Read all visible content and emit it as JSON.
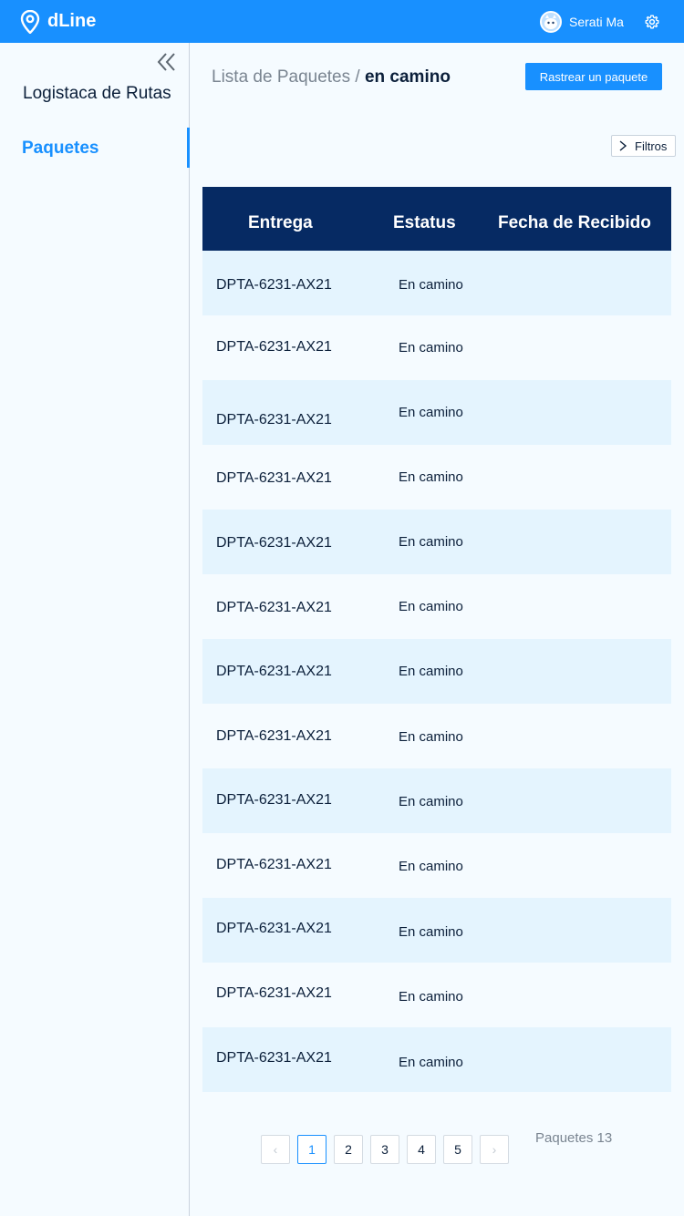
{
  "app": {
    "brand": "dLine",
    "user_name": "Serati Ma"
  },
  "sidebar": {
    "title": "Logistaca de Rutas",
    "items": [
      {
        "label": "Paquetes",
        "active": true
      }
    ]
  },
  "header": {
    "breadcrumb_parent": "Lista de Paquetes",
    "breadcrumb_separator": "/",
    "breadcrumb_current": "en camino",
    "track_button": "Rastrear un paquete",
    "filter_button": "Filtros"
  },
  "table": {
    "columns": [
      "Entrega",
      "Estatus",
      "Fecha de Recibido"
    ],
    "rows": [
      {
        "id": "DPTA-6231-AX21",
        "status": "En camino",
        "date": ""
      },
      {
        "id": "DPTA-6231-AX21",
        "status": "En camino",
        "date": ""
      },
      {
        "id": "DPTA-6231-AX21",
        "status": "En camino",
        "date": ""
      },
      {
        "id": "DPTA-6231-AX21",
        "status": "En camino",
        "date": ""
      },
      {
        "id": "DPTA-6231-AX21",
        "status": "En camino",
        "date": ""
      },
      {
        "id": "DPTA-6231-AX21",
        "status": "En camino",
        "date": ""
      },
      {
        "id": "DPTA-6231-AX21",
        "status": "En camino",
        "date": ""
      },
      {
        "id": "DPTA-6231-AX21",
        "status": "En camino",
        "date": ""
      },
      {
        "id": "DPTA-6231-AX21",
        "status": "En camino",
        "date": ""
      },
      {
        "id": "DPTA-6231-AX21",
        "status": "En camino",
        "date": ""
      },
      {
        "id": "DPTA-6231-AX21",
        "status": "En camino",
        "date": ""
      },
      {
        "id": "DPTA-6231-AX21",
        "status": "En camino",
        "date": ""
      },
      {
        "id": "DPTA-6231-AX21",
        "status": "En camino",
        "date": ""
      }
    ]
  },
  "pagination": {
    "pages": [
      "1",
      "2",
      "3",
      "4",
      "5"
    ],
    "current_page": "1",
    "prev_symbol": "‹",
    "next_symbol": "›",
    "total_label": "Paquetes 13"
  },
  "colors": {
    "primary": "#1890ff",
    "table_header": "#062a63",
    "row_shade": "#e4f4fe",
    "page_bg": "#f5fbff"
  },
  "icons": [
    "location-pin-icon",
    "avatar-icon",
    "gear-icon",
    "double-chevron-left-icon",
    "chevron-right-icon"
  ]
}
